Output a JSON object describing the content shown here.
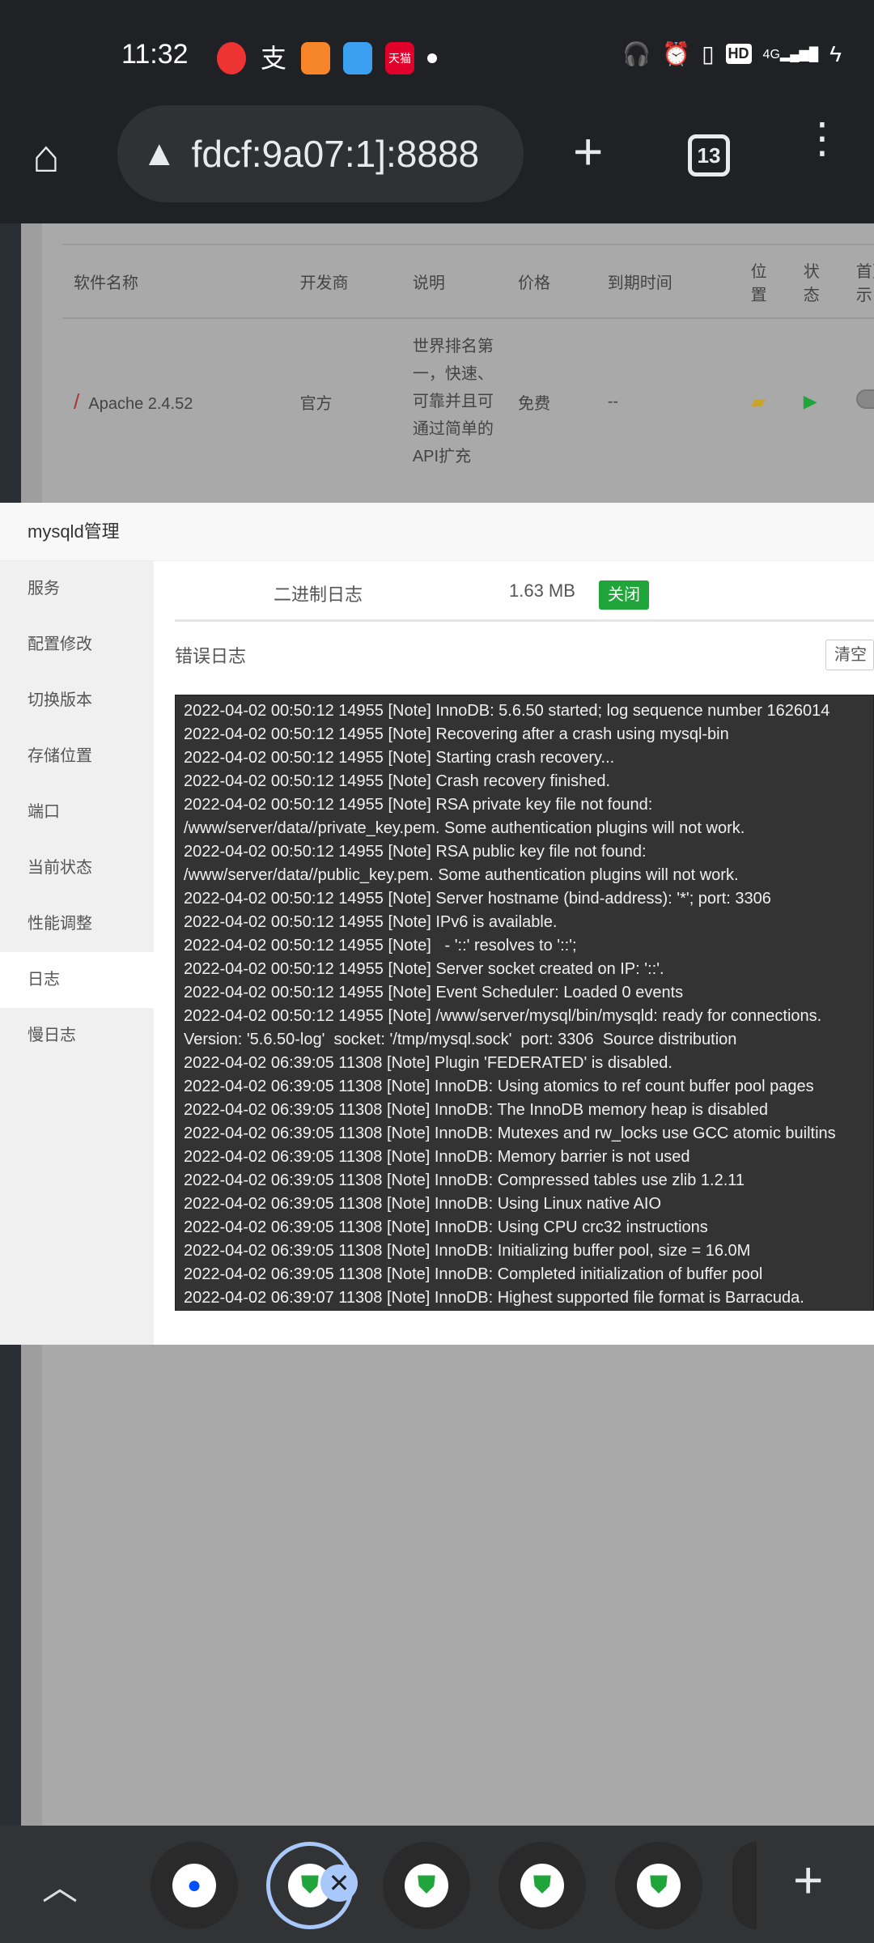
{
  "status_bar": {
    "time": "11:32",
    "notification_icons": [
      "video-app-icon",
      "alipay-icon",
      "uc-browser-icon",
      "telegram-icon",
      "tmall-icon",
      "dot-icon"
    ],
    "tmall_label": "天猫",
    "system_icons": [
      "headphones-icon",
      "alarm-icon",
      "vibrate-icon",
      "hd-icon",
      "signal-4g-icon",
      "charging-icon"
    ],
    "hd_label": "HD",
    "network_label": "4G"
  },
  "browser": {
    "url": "fdcf:9a07:1]:8888",
    "tab_count": "13"
  },
  "software_table": {
    "headers": [
      "软件名称",
      "开发商",
      "说明",
      "价格",
      "到期时间",
      "位置",
      "状态",
      "首页示"
    ],
    "rows": [
      {
        "name": "Apache 2.4.52",
        "developer": "官方",
        "description": "世界排名第一，快速、可靠并且可通过简单的API扩充",
        "price": "免费",
        "expiry": "--"
      }
    ]
  },
  "modal": {
    "title": "mysqld管理",
    "sidebar": [
      "服务",
      "配置修改",
      "切换版本",
      "存储位置",
      "端口",
      "当前状态",
      "性能调整",
      "日志",
      "慢日志"
    ],
    "active_item": "日志",
    "binary_log": {
      "label": "二进制日志",
      "size": "1.63 MB",
      "button": "关闭"
    },
    "error_log": {
      "label": "错误日志",
      "clear_button": "清空"
    },
    "log_lines": [
      "2022-04-02 00:50:12 14955 [Note] InnoDB: 5.6.50 started; log sequence number 1626014",
      "2022-04-02 00:50:12 14955 [Note] Recovering after a crash using mysql-bin",
      "2022-04-02 00:50:12 14955 [Note] Starting crash recovery...",
      "2022-04-02 00:50:12 14955 [Note] Crash recovery finished.",
      "2022-04-02 00:50:12 14955 [Note] RSA private key file not found:",
      "/www/server/data//private_key.pem. Some authentication plugins will not work.",
      "2022-04-02 00:50:12 14955 [Note] RSA public key file not found:",
      "/www/server/data//public_key.pem. Some authentication plugins will not work.",
      "2022-04-02 00:50:12 14955 [Note] Server hostname (bind-address): '*'; port: 3306",
      "2022-04-02 00:50:12 14955 [Note] IPv6 is available.",
      "2022-04-02 00:50:12 14955 [Note]   - '::' resolves to '::';",
      "2022-04-02 00:50:12 14955 [Note] Server socket created on IP: '::'.",
      "2022-04-02 00:50:12 14955 [Note] Event Scheduler: Loaded 0 events",
      "2022-04-02 00:50:12 14955 [Note] /www/server/mysql/bin/mysqld: ready for connections.",
      "Version: '5.6.50-log'  socket: '/tmp/mysql.sock'  port: 3306  Source distribution",
      "2022-04-02 06:39:05 11308 [Note] Plugin 'FEDERATED' is disabled.",
      "2022-04-02 06:39:05 11308 [Note] InnoDB: Using atomics to ref count buffer pool pages",
      "2022-04-02 06:39:05 11308 [Note] InnoDB: The InnoDB memory heap is disabled",
      "2022-04-02 06:39:05 11308 [Note] InnoDB: Mutexes and rw_locks use GCC atomic builtins",
      "2022-04-02 06:39:05 11308 [Note] InnoDB: Memory barrier is not used",
      "2022-04-02 06:39:05 11308 [Note] InnoDB: Compressed tables use zlib 1.2.11",
      "2022-04-02 06:39:05 11308 [Note] InnoDB: Using Linux native AIO",
      "2022-04-02 06:39:05 11308 [Note] InnoDB: Using CPU crc32 instructions",
      "2022-04-02 06:39:05 11308 [Note] InnoDB: Initializing buffer pool, size = 16.0M",
      "2022-04-02 06:39:05 11308 [Note] InnoDB: Completed initialization of buffer pool",
      "2022-04-02 06:39:07 11308 [Note] InnoDB: Highest supported file format is Barracuda."
    ]
  },
  "tab_strip": {
    "tabs": [
      "blue-app-icon",
      "baota-shield-icon",
      "baota-shield-icon",
      "baota-shield-icon",
      "baota-shield-icon"
    ],
    "selected": 1
  },
  "colors": {
    "accent_green": "#20a53a",
    "tab_selected": "#a8c7fa"
  }
}
